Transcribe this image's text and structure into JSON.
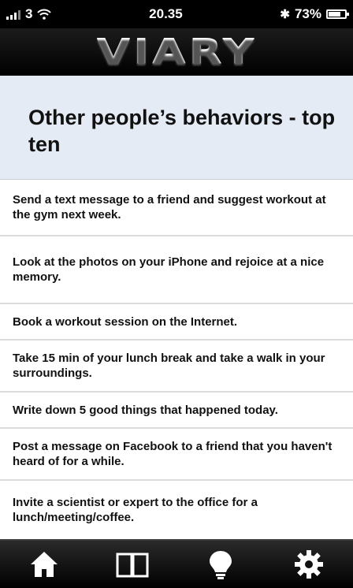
{
  "status_bar": {
    "carrier": "3",
    "time": "20.35",
    "battery": "73%",
    "battery_level": 0.73
  },
  "header": {
    "logo": "VIARY"
  },
  "page": {
    "title": "Other people’s behaviors - top ten"
  },
  "items": [
    {
      "text": "Send a text message to a friend and suggest workout at the gym next week."
    },
    {
      "text": "Look at the photos on your iPhone and rejoice at a nice memory."
    },
    {
      "text": "Book a workout session on the Internet."
    },
    {
      "text": "Take 15 min of your lunch break and take a walk in your surroundings."
    },
    {
      "text": "Write down 5 good things that happened today."
    },
    {
      "text": "Post a message on Facebook to a friend that you haven't heard of for a while."
    },
    {
      "text": "Invite a scientist or expert to the office for a lunch/meeting/coffee."
    }
  ],
  "tab_bar": {
    "icons": [
      "home-icon",
      "book-icon",
      "lightbulb-icon",
      "gear-icon"
    ]
  }
}
